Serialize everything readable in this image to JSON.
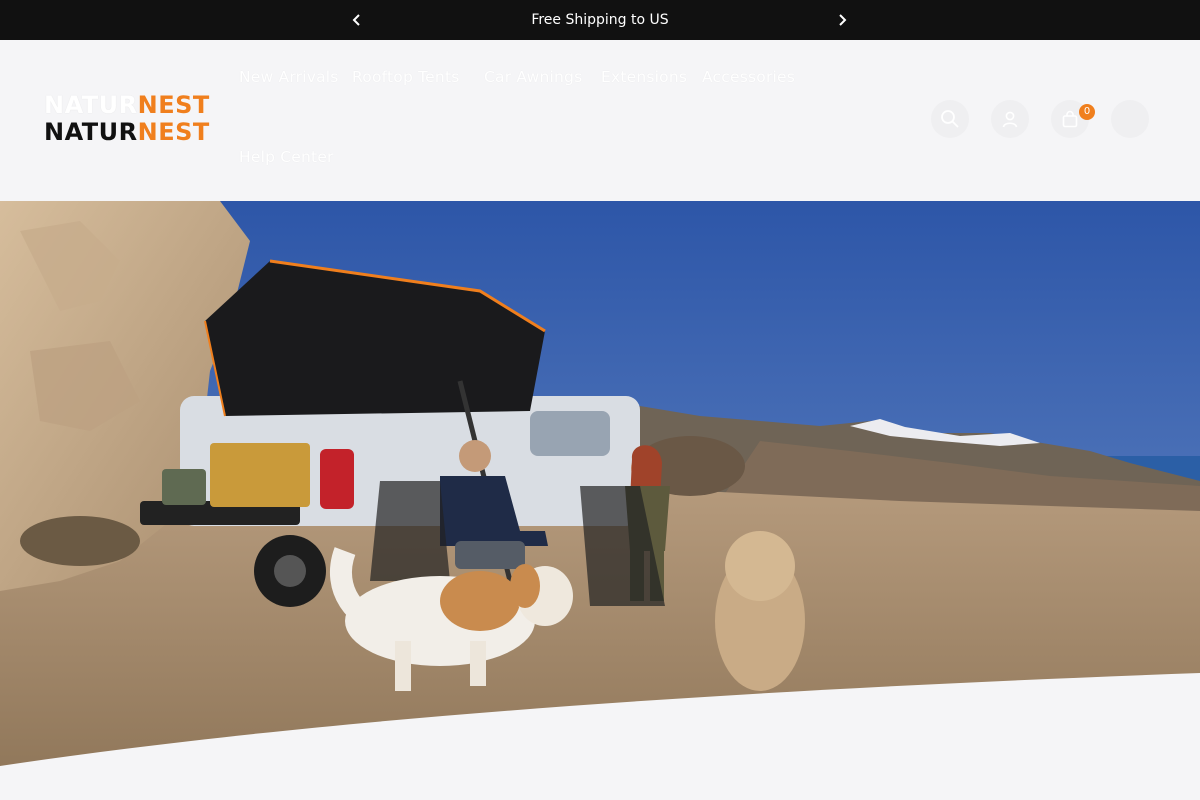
{
  "announcement": {
    "text": "Free Shipping to US",
    "prev_icon": "chevron-left-icon",
    "next_icon": "chevron-right-icon"
  },
  "brand": {
    "logo_part1": "NATUR",
    "logo_part2": "NEST",
    "accent": "#f07f1d"
  },
  "nav": {
    "items": [
      {
        "label": "New Arrivals"
      },
      {
        "label": "Rooftop Tents"
      },
      {
        "label": "Car Awnings"
      },
      {
        "label": "Extensions"
      },
      {
        "label": "Accessories"
      },
      {
        "label": "Help Center"
      }
    ]
  },
  "header_actions": {
    "search_icon": "search-icon",
    "account_icon": "user-icon",
    "cart_icon": "shopping-bag-icon",
    "cart_count": "0"
  },
  "hero": {
    "scene": "truck-rooftop-tent-desert-mountains"
  }
}
